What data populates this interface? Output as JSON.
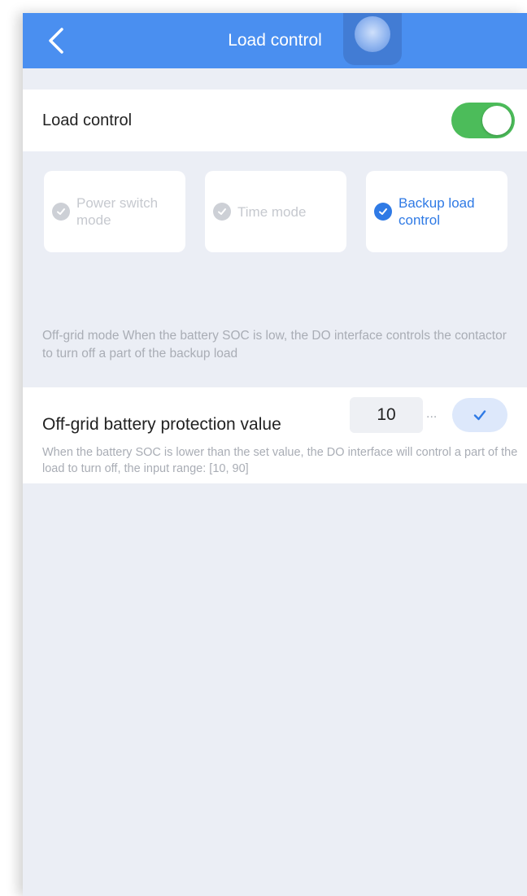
{
  "header": {
    "title": "Load control",
    "back_icon": "chevron-left-icon",
    "color": "#4a8ff0"
  },
  "load_control": {
    "label": "Load control",
    "enabled": true,
    "toggle_color": "#4cbc5a"
  },
  "modes": [
    {
      "label": "Power switch mode",
      "selected": false
    },
    {
      "label": "Time mode",
      "selected": false
    },
    {
      "label": "Backup load control",
      "selected": true
    }
  ],
  "mode_description": "Off-grid mode When the battery SOC is low, the DO interface controls the contactor to turn off a part of the backup load",
  "protection": {
    "label": "Off-grid battery protection value",
    "value": "10",
    "ellipsis": "...",
    "confirm_icon": "check-icon",
    "hint": "When the battery SOC is lower than the set value, the DO interface will control a part of the load to turn off, the input range: [10, 90]"
  },
  "accent_color": "#2f7ae5"
}
